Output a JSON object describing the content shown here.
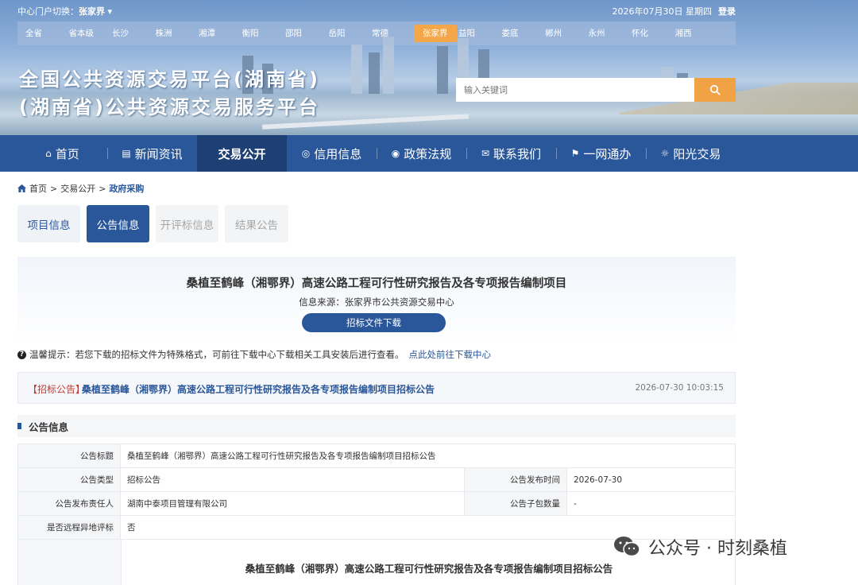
{
  "header": {
    "portal_switch_label": "中心门户切换：",
    "portal_current": "张家界",
    "date": "2026年07月30日 星期四",
    "login": "登录",
    "cities": [
      "全省",
      "省本级",
      "长沙",
      "株洲",
      "湘潭",
      "衡阳",
      "邵阳",
      "岳阳",
      "常德",
      "张家界",
      "益阳",
      "娄底",
      "郴州",
      "永州",
      "怀化",
      "湘西"
    ],
    "active_city": "张家界",
    "title_line1": "全国公共资源交易平台(湖南省)",
    "title_line2": "(湖南省)公共资源交易服务平台",
    "search_placeholder": "输入关键词"
  },
  "nav": {
    "items": [
      {
        "label": "首页",
        "icon": "home-icon"
      },
      {
        "label": "新闻资讯",
        "icon": "news-icon"
      },
      {
        "label": "交易公开",
        "icon": "",
        "active": true
      },
      {
        "label": "信用信息",
        "icon": "credit-icon"
      },
      {
        "label": "政策法规",
        "icon": "policy-icon"
      },
      {
        "label": "联系我们",
        "icon": "contact-icon"
      },
      {
        "label": "一网通办",
        "icon": "service-icon"
      },
      {
        "label": "阳光交易",
        "icon": "sunshine-icon"
      }
    ]
  },
  "breadcrumb": {
    "home": "首页",
    "level2": "交易公开",
    "current": "政府采购"
  },
  "subtabs": [
    {
      "label": "项目信息",
      "state": "normal"
    },
    {
      "label": "公告信息",
      "state": "active"
    },
    {
      "label": "开评标信息",
      "state": "disabled"
    },
    {
      "label": "结果公告",
      "state": "disabled"
    }
  ],
  "project": {
    "title": "桑植至鹤峰（湘鄂界）高速公路工程可行性研究报告及各专项报告编制项目",
    "source": "信息来源：张家界市公共资源交易中心",
    "download": "招标文件下载"
  },
  "tip": {
    "text": "温馨提示：若您下载的招标文件为特殊格式，可前往下载中心下载相关工具安装后进行查看。",
    "link": "点此处前往下载中心"
  },
  "notice": {
    "tag": "【招标公告】",
    "title": "桑植至鹤峰（湘鄂界）高速公路工程可行性研究报告及各专项报告编制项目招标公告",
    "datetime": "2026-07-30 10:03:15"
  },
  "section": {
    "title": "公告信息"
  },
  "info": {
    "announcement_title_label": "公告标题",
    "announcement_title": "桑植至鹤峰（湘鄂界）高速公路工程可行性研究报告及各专项报告编制项目招标公告",
    "type_label": "公告类型",
    "type": "招标公告",
    "publish_time_label": "公告发布时间",
    "publish_time": "2026-07-30",
    "responsible_label": "公告发布责任人",
    "responsible": "湖南中泰项目管理有限公司",
    "subpackage_label": "公告子包数量",
    "subpackage": "-",
    "remote_label": "是否远程异地评标",
    "remote": "否",
    "body_title": "桑植至鹤峰（湘鄂界）高速公路工程可行性研究报告及各专项报告编制项目招标公告"
  },
  "watermark": {
    "text": "公众号 · 时刻桑植"
  },
  "colors": {
    "primary": "#2a579a",
    "accent": "#f0a245",
    "tag_red": "#c23a32"
  }
}
